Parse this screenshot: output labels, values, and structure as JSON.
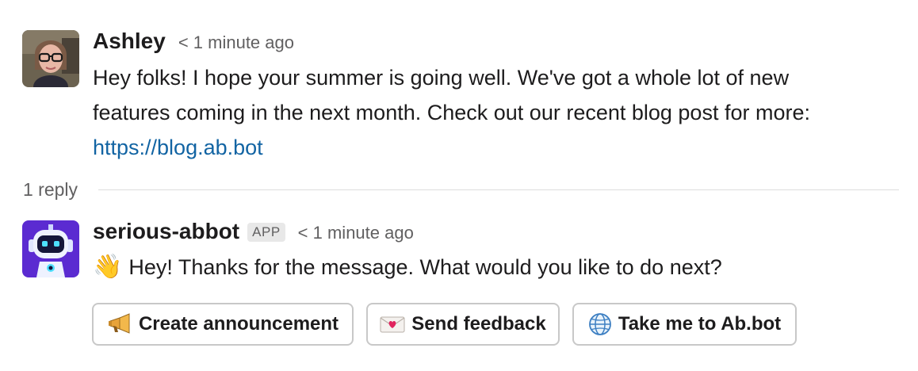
{
  "messages": [
    {
      "author": "Ashley",
      "time": "< 1 minute ago",
      "avatar": "woman-with-glasses-avatar",
      "lines": [
        "Hey folks! I hope your summer is going well. We've got a whole lot of new",
        "features coming in the next month. Check out our recent blog post for more:"
      ],
      "link": "https://blog.ab.bot"
    }
  ],
  "thread": {
    "reply_count": "1 reply"
  },
  "reply": {
    "author": "serious-abbot",
    "badge": "APP",
    "time": "< 1 minute ago",
    "avatar": "robot-avatar",
    "emoji": "👋",
    "text": "Hey! Thanks for the message. What would you like to do next?",
    "buttons": [
      {
        "label": "Create announcement",
        "icon": "megaphone-icon"
      },
      {
        "label": "Send feedback",
        "icon": "love-letter-icon"
      },
      {
        "label": "Take me to Ab.bot",
        "icon": "globe-icon"
      }
    ]
  },
  "colors": {
    "link": "#1264a3",
    "muted_text": "#616061",
    "robot_avatar_bg": "#5b2bd1",
    "button_border": "#c8c8c8"
  }
}
